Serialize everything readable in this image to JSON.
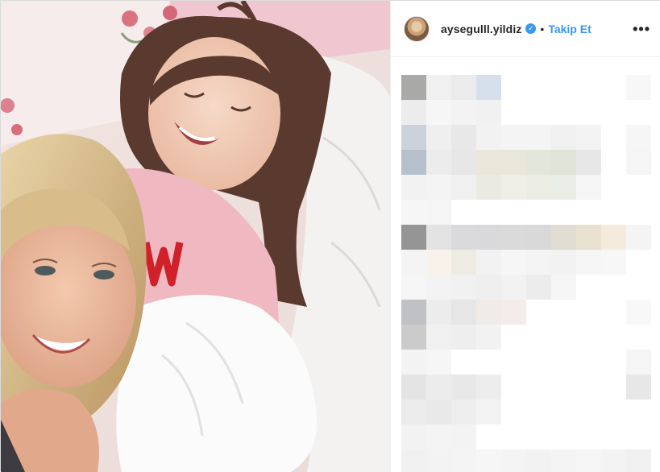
{
  "post": {
    "photo": {
      "alt": ""
    }
  },
  "header": {
    "avatar_icon": "avatar",
    "username": "aysegulll.yildiz",
    "verified_icon": "verified-badge-icon",
    "separator": "•",
    "follow_label": "Takip Et",
    "more_icon": "more-options-icon",
    "more_label": "•••"
  },
  "comments": {
    "ghost_text": "",
    "pixelated": true
  },
  "colors": {
    "accent": "#3897f0",
    "text": "#262626",
    "border": "#efefef"
  }
}
